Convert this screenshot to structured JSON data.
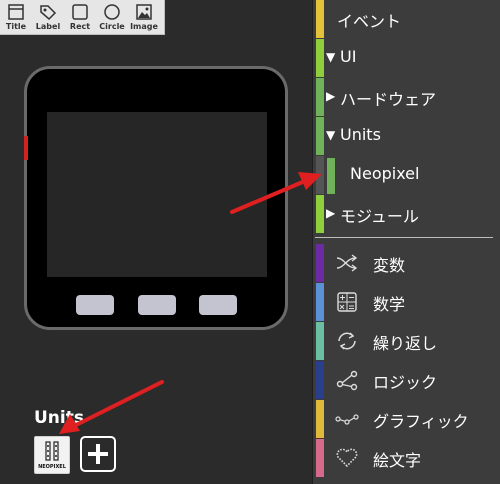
{
  "toolbox": {
    "tools": [
      {
        "label": "Title",
        "icon": "title-icon"
      },
      {
        "label": "Label",
        "icon": "label-tag-icon"
      },
      {
        "label": "Rect",
        "icon": "rect-icon"
      },
      {
        "label": "Circle",
        "icon": "circle-icon"
      },
      {
        "label": "Image",
        "icon": "image-icon"
      }
    ]
  },
  "units": {
    "heading": "Units",
    "chip_label": "NEOPIXEL",
    "add_icon": "plus-icon"
  },
  "categories": [
    {
      "label": "イベント",
      "color": "#e3c33a",
      "expand": ""
    },
    {
      "label": "UI",
      "color": "#8fcf3d",
      "expand": "▼"
    },
    {
      "label": "ハードウェア",
      "color": "#6fb25a",
      "expand": "▶"
    },
    {
      "label": "Units",
      "color": "#6fb25a",
      "expand": "▼"
    },
    {
      "label": "Neopixel",
      "color": "#6fb25a",
      "expand": ""
    },
    {
      "label": "モジュール",
      "color": "#8fcf3d",
      "expand": "▶"
    },
    {
      "label": "変数",
      "color": "#6c2aa5",
      "icon": "shuffle-icon"
    },
    {
      "label": "数学",
      "color": "#5b92d6",
      "icon": "calculator-icon"
    },
    {
      "label": "繰り返し",
      "color": "#6bbfa3",
      "icon": "loop-icon"
    },
    {
      "label": "ロジック",
      "color": "#2a3f8c",
      "icon": "branch-icon"
    },
    {
      "label": "グラフィック",
      "color": "#e1b93a",
      "icon": "graph-nodes-icon"
    },
    {
      "label": "絵文字",
      "color": "#d66a8a",
      "icon": "heart-pixel-icon"
    }
  ],
  "colors": {
    "annotation_arrow": "#e02020",
    "device_button": "#c4c4d0",
    "side_marker": "#d32222"
  }
}
